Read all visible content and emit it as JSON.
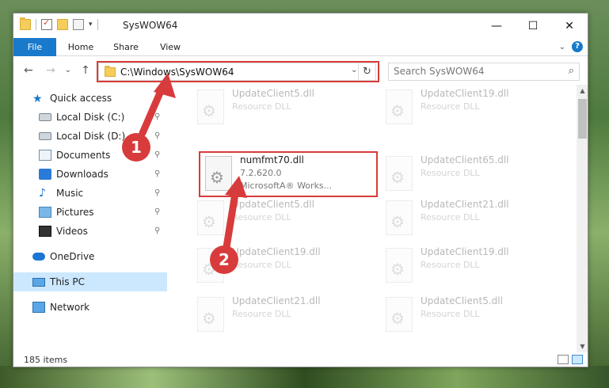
{
  "window": {
    "title": "SysWOW64",
    "controls": {
      "minimize": "—",
      "maximize": "☐",
      "close": "✕"
    }
  },
  "ribbon": {
    "tabs": [
      {
        "label": "File"
      },
      {
        "label": "Home"
      },
      {
        "label": "Share"
      },
      {
        "label": "View"
      }
    ],
    "expand_icon": "⌄",
    "help_icon": "?"
  },
  "navbar": {
    "back_icon": "←",
    "forward_icon": "→",
    "recent_icon": "⌄",
    "up_icon": "↑",
    "address_path": "C:\\Windows\\SysWOW64",
    "address_dropdown_icon": "⌄",
    "refresh_icon": "↻",
    "search_placeholder": "Search SysWOW64",
    "search_icon": "⌕"
  },
  "sidebar": {
    "items": [
      {
        "label": "Quick access",
        "icon": "star-icon",
        "pinned": false
      },
      {
        "label": "Local Disk (C:)",
        "icon": "disk-icon",
        "pinned": true
      },
      {
        "label": "Local Disk (D:)",
        "icon": "disk-icon",
        "pinned": true
      },
      {
        "label": "Documents",
        "icon": "documents-icon",
        "pinned": true
      },
      {
        "label": "Downloads",
        "icon": "downloads-icon",
        "pinned": true
      },
      {
        "label": "Music",
        "icon": "music-icon",
        "pinned": true
      },
      {
        "label": "Pictures",
        "icon": "pictures-icon",
        "pinned": true
      },
      {
        "label": "Videos",
        "icon": "videos-icon",
        "pinned": true
      },
      {
        "label": "OneDrive",
        "icon": "onedrive-icon",
        "pinned": false
      },
      {
        "label": "This PC",
        "icon": "this-pc-icon",
        "pinned": false,
        "selected": true
      },
      {
        "label": "Network",
        "icon": "network-icon",
        "pinned": false
      }
    ],
    "pin_glyph": "📌"
  },
  "files": [
    {
      "name": "UpdateClient5.dll",
      "line2": "Resource DLL",
      "line3": ""
    },
    {
      "name": "UpdateClient19.dll",
      "line2": "Resource DLL",
      "line3": ""
    },
    {
      "name": "numfmt70.dll",
      "line2": "7.2.620.0",
      "line3": "MicrosoftA® Works..."
    },
    {
      "name": "UpdateClient65.dll",
      "line2": "Resource DLL",
      "line3": ""
    },
    {
      "name": "UpdateClient5.dll",
      "line2": "Resource DLL",
      "line3": ""
    },
    {
      "name": "UpdateClient21.dll",
      "line2": "Resource DLL",
      "line3": ""
    },
    {
      "name": "UpdateClient19.dll",
      "line2": "Resource DLL",
      "line3": ""
    },
    {
      "name": "UpdateClient19.dll",
      "line2": "Resource DLL",
      "line3": ""
    },
    {
      "name": "UpdateClient21.dll",
      "line2": "Resource DLL",
      "line3": ""
    },
    {
      "name": "UpdateClient5.dll",
      "line2": "Resource DLL",
      "line3": ""
    }
  ],
  "status": {
    "item_count": "185 items"
  },
  "annotations": {
    "step1": "1",
    "step2": "2",
    "color": "#d83b3b"
  },
  "colors": {
    "accent": "#1979ca",
    "selection": "#cce8ff",
    "highlight": "#d83b3b"
  }
}
